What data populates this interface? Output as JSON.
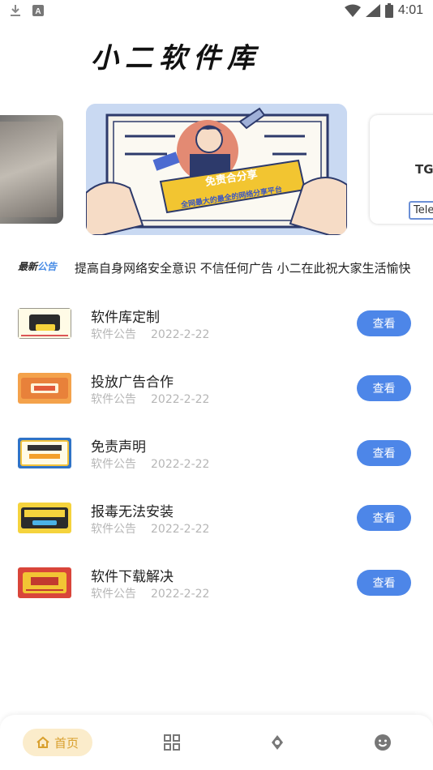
{
  "status_bar": {
    "time": "4:01",
    "icons": [
      "download-icon",
      "a-notification-icon",
      "wifi-icon",
      "signal-icon",
      "battery-icon"
    ]
  },
  "header": {
    "logo_text": "小二软件库"
  },
  "carousel": {
    "center_banner": {
      "headline": "免责合分享",
      "subline": "全网最大的最全的网络分享平台"
    },
    "right_card": {
      "title": "TG",
      "subtitle": "Tele"
    }
  },
  "notice": {
    "badge_part1": "最新",
    "badge_part2": "公告",
    "text": "提高自身网络安全意识  不信任何广告  小二在此祝大家生活愉快"
  },
  "posts": [
    {
      "title": "软件库定制",
      "category": "软件公告",
      "date": "2022-2-22",
      "button": "查看",
      "thumb": "custom-thumbnail"
    },
    {
      "title": "投放广告合作",
      "category": "软件公告",
      "date": "2022-2-22",
      "button": "查看",
      "thumb": "ad-cooperation-thumbnail"
    },
    {
      "title": "免责声明",
      "category": "软件公告",
      "date": "2022-2-22",
      "button": "查看",
      "thumb": "disclaimer-thumbnail"
    },
    {
      "title": "报毒无法安装",
      "category": "软件公告",
      "date": "2022-2-22",
      "button": "查看",
      "thumb": "virus-install-thumbnail"
    },
    {
      "title": "软件下载解决",
      "category": "软件公告",
      "date": "2022-2-22",
      "button": "查看",
      "thumb": "download-fix-thumbnail"
    }
  ],
  "tabbar": {
    "home_label": "首页",
    "icons": [
      "home-icon",
      "grid-icon",
      "discover-icon",
      "smile-icon"
    ],
    "active_color": "#d9a02e"
  },
  "colors": {
    "accent": "#4d86e8",
    "meta_gray": "#b6b6b6"
  }
}
